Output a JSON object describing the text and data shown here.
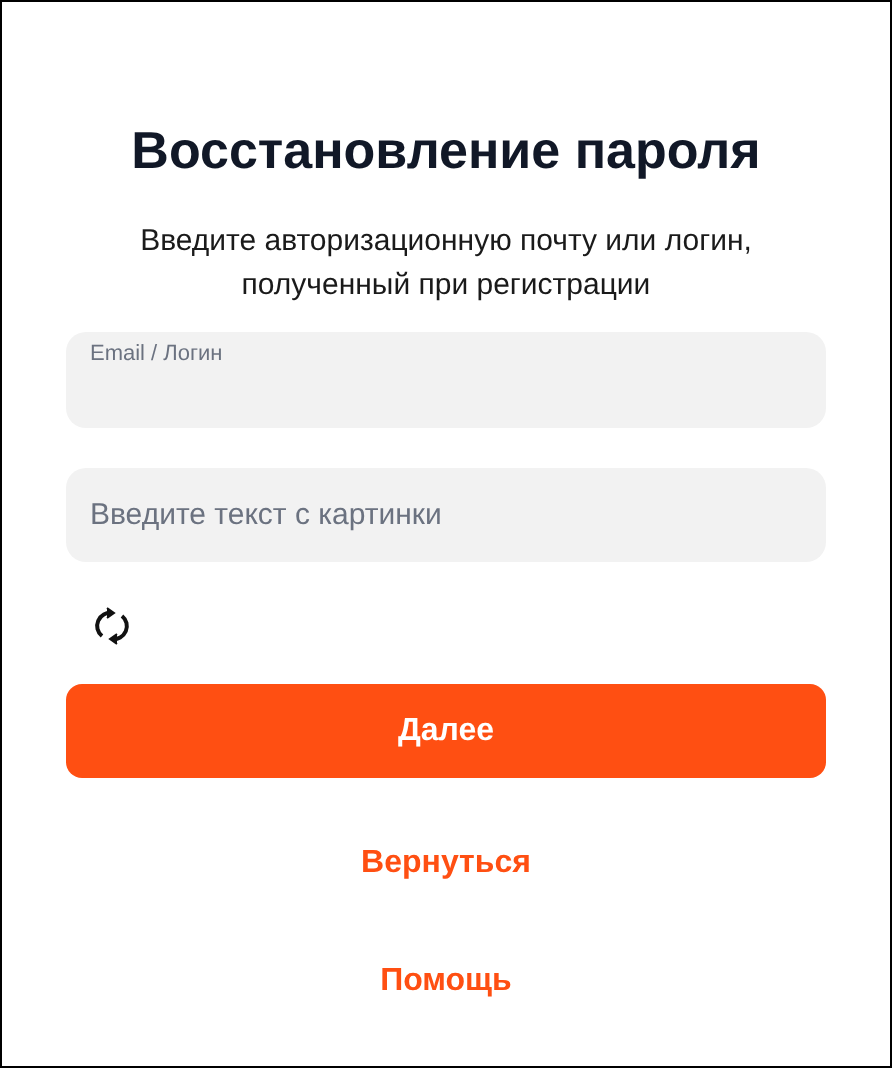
{
  "title": "Восстановление пароля",
  "subtitle": "Введите авторизационную почту или логин, полученный при регистрации",
  "login_field": {
    "label": "Email / Логин"
  },
  "captcha_field": {
    "placeholder": "Введите текст с картинки"
  },
  "submit_button": "Далее",
  "back_link": "Вернуться",
  "help_link": "Помощь"
}
